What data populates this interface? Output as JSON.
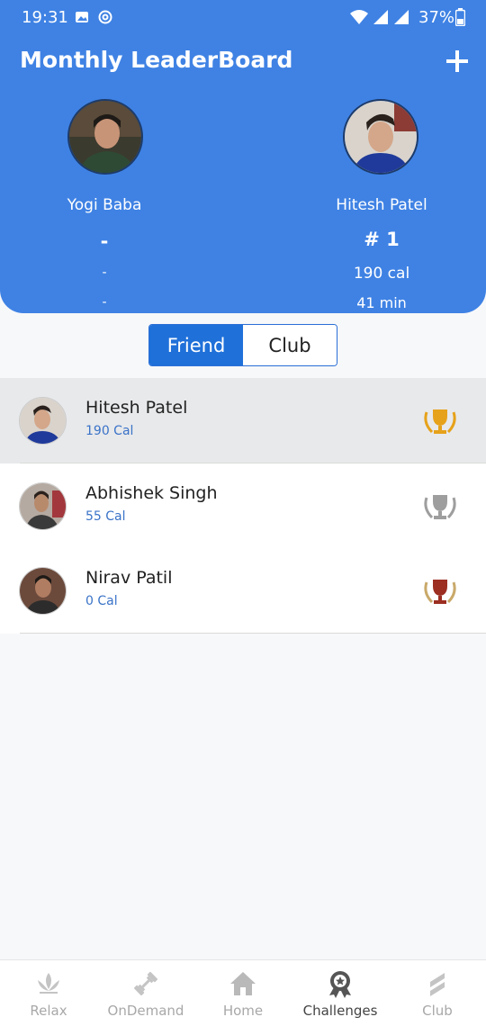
{
  "status_bar": {
    "time": "19:31",
    "battery": "37%"
  },
  "header": {
    "title": "Monthly LeaderBoard",
    "left_user": {
      "name": "Yogi Baba",
      "rank": "-",
      "cal": "-",
      "min": "-"
    },
    "right_user": {
      "name": "Hitesh Patel",
      "rank": "# 1",
      "cal": "190 cal",
      "min": "41 min"
    }
  },
  "toggle": {
    "friend": "Friend",
    "club": "Club",
    "selected": "Friend"
  },
  "list": [
    {
      "name": "Hitesh Patel",
      "cal": "190 Cal",
      "trophy": "gold"
    },
    {
      "name": "Abhishek Singh",
      "cal": "55 Cal",
      "trophy": "silver"
    },
    {
      "name": "Nirav Patil",
      "cal": "0 Cal",
      "trophy": "bronze"
    }
  ],
  "nav": [
    {
      "label": "Relax",
      "icon": "lotus-icon"
    },
    {
      "label": "OnDemand",
      "icon": "dumbbell-icon"
    },
    {
      "label": "Home",
      "icon": "home-icon"
    },
    {
      "label": "Challenges",
      "icon": "medal-icon",
      "active": true
    },
    {
      "label": "Club",
      "icon": "club-icon"
    }
  ],
  "colors": {
    "header": "#3f82e4",
    "accent": "#1f70d9",
    "gold": "#e6a21a",
    "silver": "#9e9e9e",
    "bronze": "#9c2e22"
  }
}
